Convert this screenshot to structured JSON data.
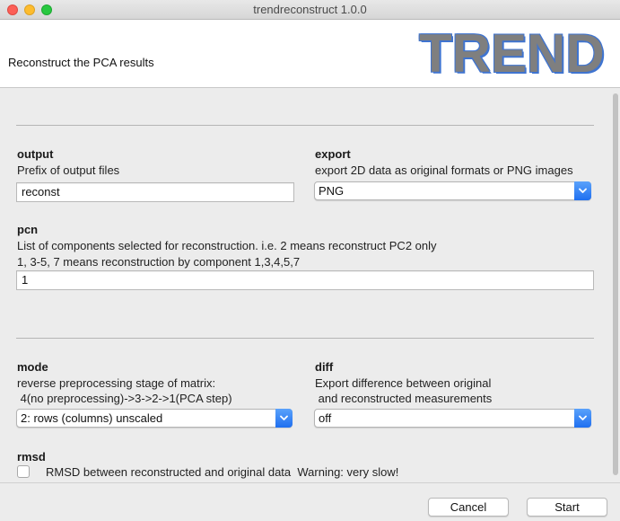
{
  "window": {
    "title": "trendreconstruct 1.0.0"
  },
  "header": {
    "title": "Reconstruct the PCA results",
    "logo_text": "TREND"
  },
  "output": {
    "label": "output",
    "desc": "Prefix of output files",
    "value": "reconst"
  },
  "export": {
    "label": "export",
    "desc": "export 2D data as original formats or PNG images",
    "selected": "PNG"
  },
  "pcn": {
    "label": "pcn",
    "desc_line1": "List of components selected for reconstruction. i.e. 2 means reconstruct PC2 only",
    "desc_line2": "1, 3-5, 7 means reconstruction by component 1,3,4,5,7",
    "value": "1"
  },
  "mode": {
    "label": "mode",
    "desc_line1": "reverse preprocessing stage of matrix:",
    "desc_line2": " 4(no preprocessing)->3->2->1(PCA step)",
    "selected": "2: rows (columns) unscaled"
  },
  "diff": {
    "label": "diff",
    "desc_line1": "Export difference between original",
    "desc_line2": " and reconstructed measurements",
    "selected": "off"
  },
  "rmsd": {
    "label": "rmsd",
    "checkbox_label": "RMSD between reconstructed and original data  Warning: very slow!",
    "checked": false
  },
  "buttons": {
    "cancel": "Cancel",
    "start": "Start"
  },
  "colors": {
    "accent": "#2b7cf5",
    "logo_fill": "#7f7f7f",
    "logo_outline": "#3f74d0"
  }
}
